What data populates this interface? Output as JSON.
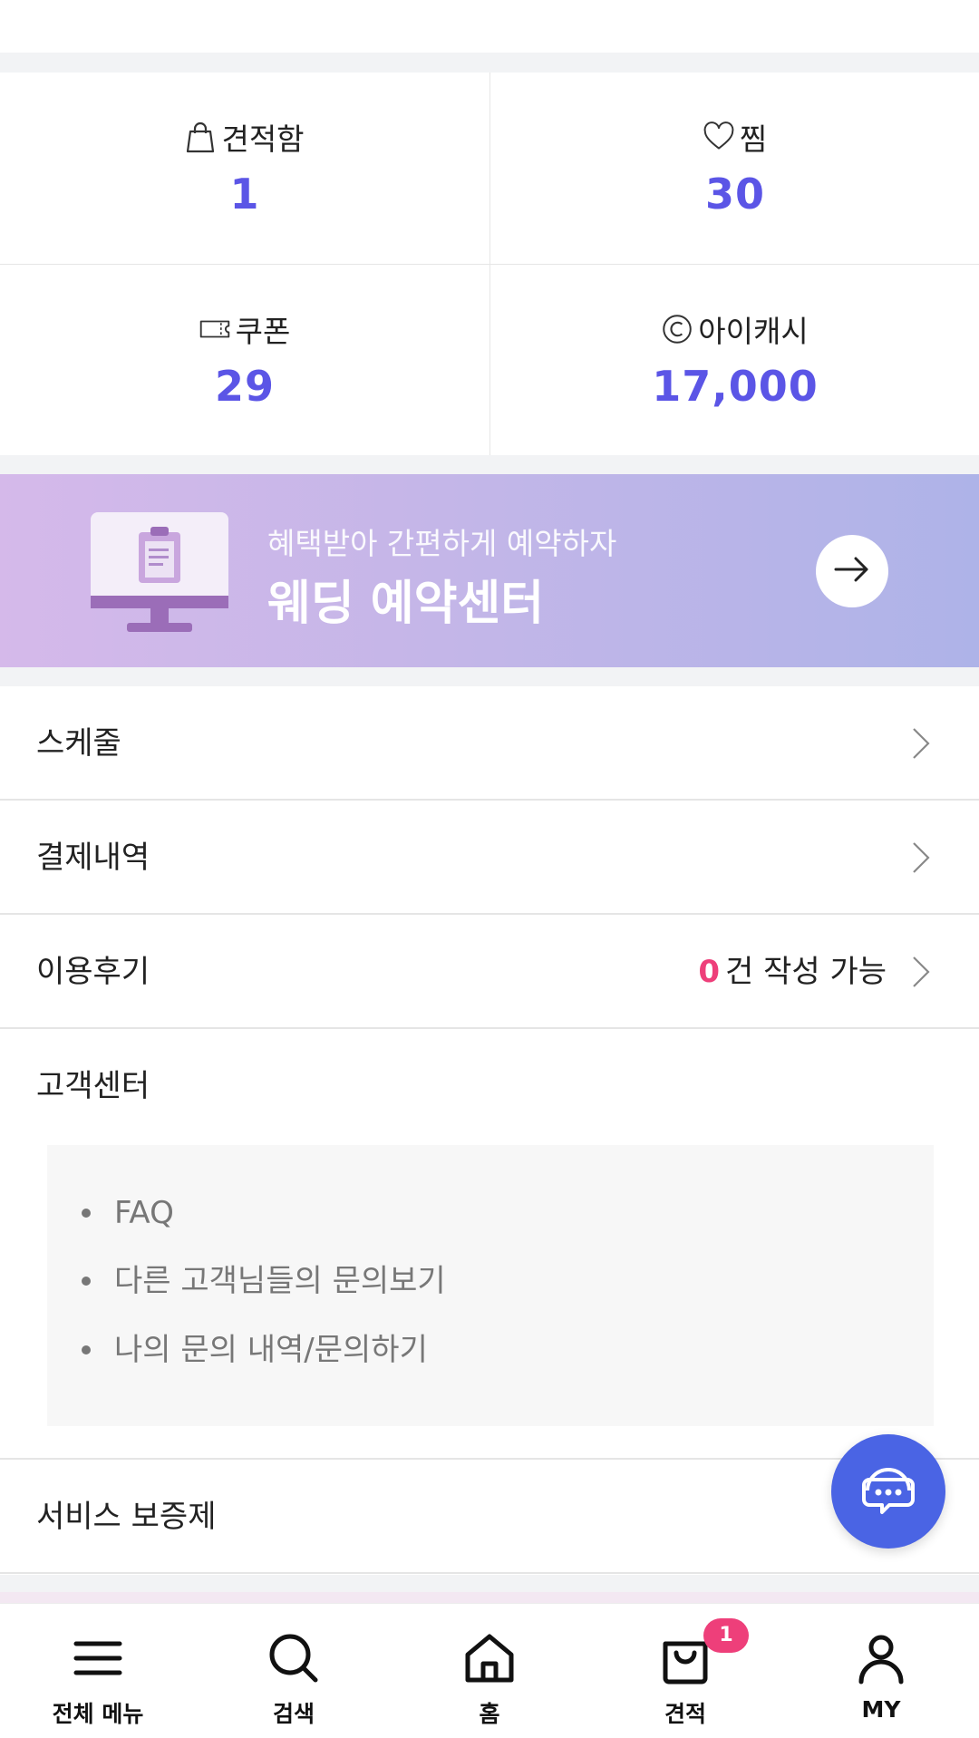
{
  "stats": [
    {
      "label": "견적함",
      "value": "1",
      "icon": "bag-icon"
    },
    {
      "label": "찜",
      "value": "30",
      "icon": "heart-icon"
    },
    {
      "label": "쿠폰",
      "value": "29",
      "icon": "coupon-icon"
    },
    {
      "label": "아이캐시",
      "value": "17,000",
      "icon": "copyright-coin-icon"
    }
  ],
  "banner": {
    "subtitle": "혜택받아 간편하게 예약하자",
    "title": "웨딩 예약센터"
  },
  "menu": {
    "schedule": "스케줄",
    "payments": "결제내역",
    "reviews": "이용후기",
    "review_count": "0",
    "review_suffix": "건 작성 가능",
    "customer_center": "고객센터",
    "service_guarantee": "서비스 보증제"
  },
  "customer_center_links": [
    "FAQ",
    "다른 고객님들의 문의보기",
    "나의 문의 내역/문의하기"
  ],
  "tabbar": {
    "items": [
      {
        "label": "전체 메뉴",
        "icon": "hamburger-icon"
      },
      {
        "label": "검색",
        "icon": "search-icon"
      },
      {
        "label": "홈",
        "icon": "home-icon"
      },
      {
        "label": "견적",
        "icon": "shopping-bag-icon",
        "badge": "1"
      },
      {
        "label": "MY",
        "icon": "user-icon"
      }
    ]
  },
  "colors": {
    "accent": "#5b55e6",
    "pink": "#ee3f7a",
    "fab": "#4a64e4"
  }
}
